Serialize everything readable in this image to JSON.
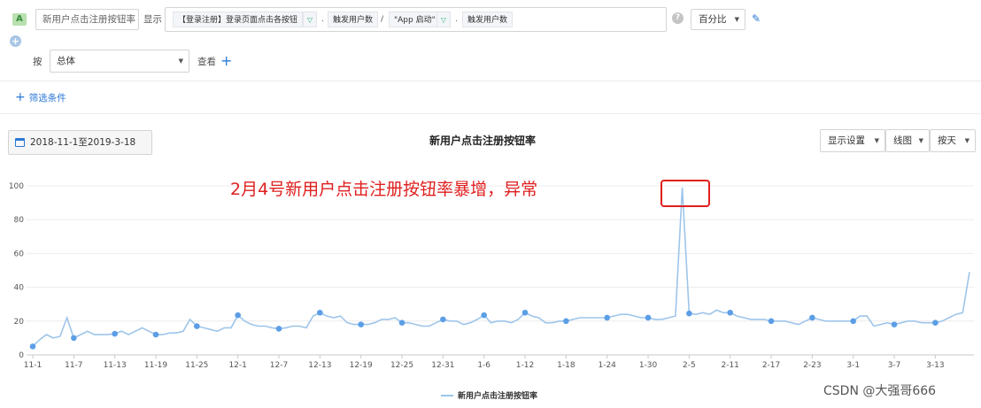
{
  "toolbar": {
    "badge": "A",
    "metric_name": "新用户点击注册按钮率",
    "show_label": "显示",
    "formula": {
      "event1": "【登录注册】登录页面点击各按钮",
      "sep1": ".",
      "measure1": "触发用户数",
      "divide": "/",
      "event2": "\"App 启动\"",
      "sep2": ".",
      "measure2": "触发用户数"
    },
    "help": "?",
    "display_mode": "百分比",
    "by_label": "按",
    "group_by": "总体",
    "view_label": "查看",
    "filter_label": "筛选条件"
  },
  "chart_header": {
    "date_range": "2018-11-1至2019-3-18",
    "title": "新用户点击注册按钮率",
    "display_settings": "显示设置",
    "chart_type": "线图",
    "granularity": "按天"
  },
  "annotation": {
    "text": "2月4号新用户点击注册按钮率暴增，异常"
  },
  "watermark": "CSDN @大强哥666",
  "chart_data": {
    "type": "line",
    "title": "新用户点击注册按钮率",
    "series_name": "新用户点击注册按钮率",
    "line_color": "#9ec5ea",
    "marker_color": "#5c9ee6",
    "ylim": [
      0,
      100
    ],
    "yticks": [
      0,
      20,
      40,
      60,
      80,
      100
    ],
    "xticks": [
      {
        "i": 0,
        "label": "11-1"
      },
      {
        "i": 6,
        "label": "11-7"
      },
      {
        "i": 12,
        "label": "11-13"
      },
      {
        "i": 18,
        "label": "11-19"
      },
      {
        "i": 24,
        "label": "11-25"
      },
      {
        "i": 30,
        "label": "12-1"
      },
      {
        "i": 36,
        "label": "12-7"
      },
      {
        "i": 42,
        "label": "12-13"
      },
      {
        "i": 48,
        "label": "12-19"
      },
      {
        "i": 54,
        "label": "12-25"
      },
      {
        "i": 60,
        "label": "12-31"
      },
      {
        "i": 66,
        "label": "1-6"
      },
      {
        "i": 72,
        "label": "1-12"
      },
      {
        "i": 78,
        "label": "1-18"
      },
      {
        "i": 84,
        "label": "1-24"
      },
      {
        "i": 90,
        "label": "1-30"
      },
      {
        "i": 96,
        "label": "2-5"
      },
      {
        "i": 102,
        "label": "2-11"
      },
      {
        "i": 108,
        "label": "2-17"
      },
      {
        "i": 114,
        "label": "2-23"
      },
      {
        "i": 120,
        "label": "3-1"
      },
      {
        "i": 126,
        "label": "3-7"
      },
      {
        "i": 132,
        "label": "3-13"
      }
    ],
    "values": [
      5,
      9,
      12,
      10,
      11,
      22,
      10,
      12,
      14,
      12,
      12,
      12,
      12.5,
      14,
      12,
      14,
      16,
      14,
      12,
      12,
      13,
      13,
      14,
      21,
      17,
      16,
      15,
      14,
      16,
      16,
      23.5,
      20,
      18,
      17,
      17,
      16,
      15.5,
      16,
      17,
      17,
      16,
      23,
      25,
      23,
      22,
      23,
      19,
      18,
      18,
      18,
      19,
      21,
      21,
      22,
      19,
      19,
      18,
      17,
      17,
      19,
      21,
      20,
      20,
      18,
      19,
      21,
      23.5,
      19,
      20,
      20,
      19,
      21,
      25,
      23,
      22,
      19,
      19,
      20,
      20,
      21,
      22,
      22,
      22,
      22,
      22,
      23,
      24,
      24,
      23,
      22,
      22,
      21,
      21,
      22,
      23,
      99,
      24.5,
      24,
      25,
      24,
      26.5,
      25,
      25,
      23,
      22,
      21,
      21,
      21,
      20,
      20,
      20,
      19,
      18,
      20,
      22,
      21,
      20,
      20,
      20,
      20,
      20,
      23,
      23,
      17,
      18,
      19,
      18,
      19,
      20,
      20,
      19,
      19,
      19,
      20,
      22,
      24,
      25,
      49
    ],
    "marker_indices": [
      0,
      6,
      12,
      18,
      24,
      30,
      36,
      42,
      48,
      54,
      60,
      66,
      72,
      78,
      84,
      90,
      96,
      102,
      108,
      114,
      120,
      126,
      132
    ]
  }
}
